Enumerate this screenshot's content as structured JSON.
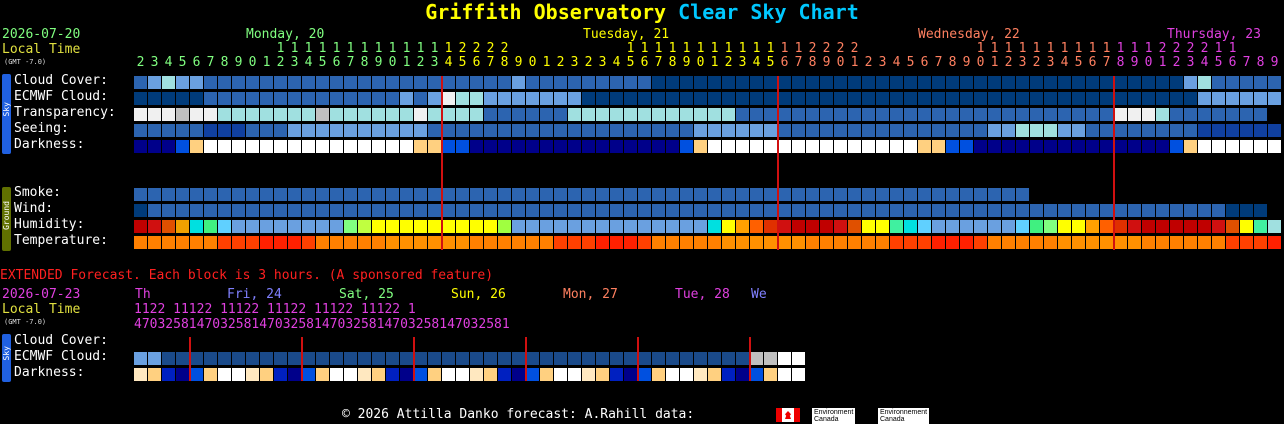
{
  "header": {
    "title_part1": "Griffith Observatory",
    "title_part2": "Clear Sky Chart"
  },
  "hourly": {
    "date_label": "2026-07-20",
    "local_time_label": "Local Time",
    "gmt_label": "(GMT -7.0)",
    "days": [
      {
        "label": "Monday, 20",
        "color": "#80ff80"
      },
      {
        "label": "Tuesday, 21",
        "color": "#ffff00"
      },
      {
        "label": "Wednesday, 22",
        "color": "#ff8060"
      },
      {
        "label": "Thursday, 23",
        "color": "#e040e0"
      }
    ],
    "tens_rows": [
      "          11111111111112222",
      "        11111111111112222",
      "        11111111111112222",
      "11"
    ],
    "hour_digits": [
      "23456789012345678901234567890123",
      "23456789012345678901234567890123",
      "23456789012345678901234567890123",
      "0123456789011"
    ],
    "sky_tab_label": "Sky",
    "ground_tab_label": "Ground",
    "sky_rows": [
      {
        "label": "Cloud Cover:"
      },
      {
        "label": "ECMWF Cloud:"
      },
      {
        "label": "Transparency:"
      },
      {
        "label": "Seeing:"
      },
      {
        "label": "Darkness:"
      }
    ],
    "ground_rows": [
      {
        "label": "Smoke:"
      },
      {
        "label": "Wind:"
      },
      {
        "label": "Humidity:"
      },
      {
        "label": "Temperature:"
      }
    ]
  },
  "extended": {
    "notice": "EXTENDED Forecast. Each block is 3 hours. (A sponsored feature)",
    "date_label": "2026-07-23",
    "local_time_label": "Local Time",
    "gmt_label": "(GMT -7.0)",
    "days": [
      {
        "label": "Th",
        "color": "#e040e0"
      },
      {
        "label": "Fri, 24",
        "color": "#8080ff"
      },
      {
        "label": "Sat, 25",
        "color": "#80ff80"
      },
      {
        "label": "Sun, 26",
        "color": "#ffff00"
      },
      {
        "label": "Mon, 27",
        "color": "#ff8060"
      },
      {
        "label": "Tue, 28",
        "color": "#e040e0"
      },
      {
        "label": "We",
        "color": "#8080ff"
      }
    ],
    "tens_row": "1122   11122   11122   11122   11122   11122   1",
    "hour_digits": "470325814703258147032581470325814703258147032581",
    "sky_tab_label": "Sky",
    "rows": [
      {
        "label": "Cloud Cover:"
      },
      {
        "label": "ECMWF Cloud:"
      },
      {
        "label": "Darkness:"
      }
    ]
  },
  "footer": {
    "text": "© 2026 Attilla Danko  forecast: A.Rahill  data:",
    "source_line1": "Environment",
    "source_line2": "Canada",
    "source_line3": "Environnement",
    "source_line4": "Canada"
  },
  "colors": {
    "cloud_clear": "#003b7a",
    "cloud_mid": "#3a78c0",
    "cloud_light": "#7ab0e8",
    "cloud_cyan": "#a0e0e0",
    "cloud_white": "#f0f0f0",
    "grey": "#c0c0c0",
    "midnight_line": "#d01010",
    "sky_tab": "#2060e0",
    "ground_tab": "#607000"
  }
}
